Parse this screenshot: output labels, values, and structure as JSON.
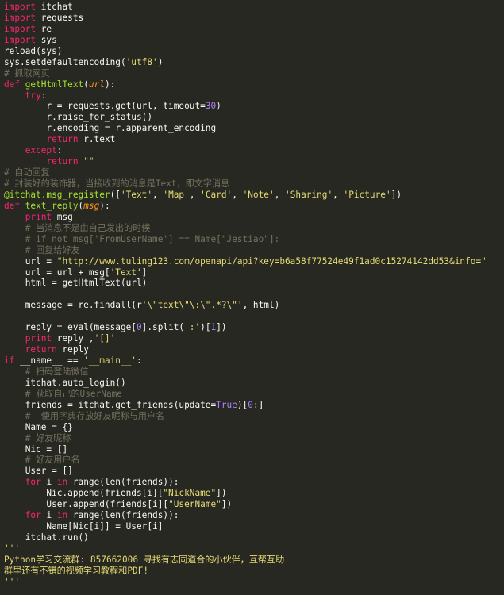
{
  "editor": {
    "theme_colors": {
      "background": "#272822",
      "keyword": "#f92672",
      "string": "#e6db74",
      "number": "#ae81ff",
      "comment": "#75715e",
      "function": "#a6e22e",
      "text": "#f8f8f2"
    },
    "lines": [
      [
        [
          "kw",
          "import"
        ],
        [
          "plain",
          " itchat"
        ]
      ],
      [
        [
          "kw",
          "import"
        ],
        [
          "plain",
          " requests"
        ]
      ],
      [
        [
          "kw",
          "import"
        ],
        [
          "plain",
          " re"
        ]
      ],
      [
        [
          "kw",
          "import"
        ],
        [
          "plain",
          " sys"
        ]
      ],
      [
        [
          "plain",
          "reload(sys)"
        ]
      ],
      [
        [
          "plain",
          "sys.setdefaultencoding("
        ],
        [
          "str",
          "'utf8'"
        ],
        [
          "plain",
          ")"
        ]
      ],
      [
        [
          "cmt",
          "# 抓取网页"
        ]
      ],
      [
        [
          "kw",
          "def"
        ],
        [
          "plain",
          " "
        ],
        [
          "fn",
          "getHtmlText"
        ],
        [
          "plain",
          "("
        ],
        [
          "param",
          "url"
        ],
        [
          "plain",
          "):"
        ]
      ],
      [
        [
          "plain",
          "    "
        ],
        [
          "kw",
          "try"
        ],
        [
          "plain",
          ":"
        ]
      ],
      [
        [
          "plain",
          "        r = requests.get(url, timeout="
        ],
        [
          "num",
          "30"
        ],
        [
          "plain",
          ")"
        ]
      ],
      [
        [
          "plain",
          "        r.raise_for_status()"
        ]
      ],
      [
        [
          "plain",
          "        r.encoding = r.apparent_encoding"
        ]
      ],
      [
        [
          "plain",
          "        "
        ],
        [
          "kw",
          "return"
        ],
        [
          "plain",
          " r.text"
        ]
      ],
      [
        [
          "plain",
          "    "
        ],
        [
          "kw",
          "except"
        ],
        [
          "plain",
          ":"
        ]
      ],
      [
        [
          "plain",
          "        "
        ],
        [
          "kw",
          "return"
        ],
        [
          "plain",
          " "
        ],
        [
          "str",
          "\"\""
        ]
      ],
      [
        [
          "cmt",
          "# 自动回复"
        ]
      ],
      [
        [
          "cmt",
          "# 封装好的装饰器，当接收到的消息是Text，即文字消息"
        ]
      ],
      [
        [
          "dec",
          "@itchat.msg_register"
        ],
        [
          "plain",
          "(["
        ],
        [
          "str",
          "'Text'"
        ],
        [
          "plain",
          ", "
        ],
        [
          "str",
          "'Map'"
        ],
        [
          "plain",
          ", "
        ],
        [
          "str",
          "'Card'"
        ],
        [
          "plain",
          ", "
        ],
        [
          "str",
          "'Note'"
        ],
        [
          "plain",
          ", "
        ],
        [
          "str",
          "'Sharing'"
        ],
        [
          "plain",
          ", "
        ],
        [
          "str",
          "'Picture'"
        ],
        [
          "plain",
          "])"
        ]
      ],
      [
        [
          "kw",
          "def"
        ],
        [
          "plain",
          " "
        ],
        [
          "fn",
          "text_reply"
        ],
        [
          "plain",
          "("
        ],
        [
          "param",
          "msg"
        ],
        [
          "plain",
          "):"
        ]
      ],
      [
        [
          "plain",
          "    "
        ],
        [
          "kw",
          "print"
        ],
        [
          "plain",
          " msg"
        ]
      ],
      [
        [
          "plain",
          "    "
        ],
        [
          "cmt",
          "# 当消息不是由自己发出的时候"
        ]
      ],
      [
        [
          "plain",
          "    "
        ],
        [
          "cmt",
          "# if not msg['FromUserName'] == Name[\"Jestiao\"]:"
        ]
      ],
      [
        [
          "plain",
          "    "
        ],
        [
          "cmt",
          "# 回复给好友"
        ]
      ],
      [
        [
          "plain",
          "    url = "
        ],
        [
          "str",
          "\"http://www.tuling123.com/openapi/api?key=b6a58f77524e49f1ad0c15274142dd53&info=\""
        ]
      ],
      [
        [
          "plain",
          "    url = url + msg["
        ],
        [
          "str",
          "'Text'"
        ],
        [
          "plain",
          "]"
        ]
      ],
      [
        [
          "plain",
          "    html = getHtmlText(url)"
        ]
      ],
      [
        [
          "plain",
          ""
        ]
      ],
      [
        [
          "plain",
          "    message = re.findall(r"
        ],
        [
          "str",
          "'\\\"text\\\"\\:\\\".*?\\\"'"
        ],
        [
          "plain",
          ", html)"
        ]
      ],
      [
        [
          "plain",
          ""
        ]
      ],
      [
        [
          "plain",
          "    reply = eval(message["
        ],
        [
          "num",
          "0"
        ],
        [
          "plain",
          "].split("
        ],
        [
          "str",
          "':'"
        ],
        [
          "plain",
          ")["
        ],
        [
          "num",
          "1"
        ],
        [
          "plain",
          "])"
        ]
      ],
      [
        [
          "plain",
          "    "
        ],
        [
          "kw",
          "print"
        ],
        [
          "plain",
          " reply ,"
        ],
        [
          "str",
          "'[]'"
        ]
      ],
      [
        [
          "plain",
          "    "
        ],
        [
          "kw",
          "return"
        ],
        [
          "plain",
          " reply"
        ]
      ],
      [
        [
          "kw",
          "if"
        ],
        [
          "plain",
          " __name__ == "
        ],
        [
          "str",
          "'__main__'"
        ],
        [
          "plain",
          ":"
        ]
      ],
      [
        [
          "plain",
          "    "
        ],
        [
          "cmt",
          "# 扫码登陆微信"
        ]
      ],
      [
        [
          "plain",
          "    itchat.auto_login()"
        ]
      ],
      [
        [
          "plain",
          "    "
        ],
        [
          "cmt",
          "# 获取自己的UserName"
        ]
      ],
      [
        [
          "plain",
          "    friends = itchat.get_friends(update="
        ],
        [
          "num",
          "True"
        ],
        [
          "plain",
          ")["
        ],
        [
          "num",
          "0"
        ],
        [
          "plain",
          ":]"
        ]
      ],
      [
        [
          "plain",
          "    "
        ],
        [
          "cmt",
          "#  使用字典存放好友昵称与用户名"
        ]
      ],
      [
        [
          "plain",
          "    Name = {}"
        ]
      ],
      [
        [
          "plain",
          "    "
        ],
        [
          "cmt",
          "# 好友昵称"
        ]
      ],
      [
        [
          "plain",
          "    Nic = []"
        ]
      ],
      [
        [
          "plain",
          "    "
        ],
        [
          "cmt",
          "# 好友用户名"
        ]
      ],
      [
        [
          "plain",
          "    User = []"
        ]
      ],
      [
        [
          "plain",
          "    "
        ],
        [
          "kw",
          "for"
        ],
        [
          "plain",
          " i "
        ],
        [
          "kw",
          "in"
        ],
        [
          "plain",
          " range(len(friends)):"
        ]
      ],
      [
        [
          "plain",
          "        Nic.append(friends[i]["
        ],
        [
          "str",
          "\"NickName\""
        ],
        [
          "plain",
          "])"
        ]
      ],
      [
        [
          "plain",
          "        User.append(friends[i]["
        ],
        [
          "str",
          "\"UserName\""
        ],
        [
          "plain",
          "])"
        ]
      ],
      [
        [
          "plain",
          "    "
        ],
        [
          "kw",
          "for"
        ],
        [
          "plain",
          " i "
        ],
        [
          "kw",
          "in"
        ],
        [
          "plain",
          " range(len(friends)):"
        ]
      ],
      [
        [
          "plain",
          "        Name[Nic[i]] = User[i]"
        ]
      ],
      [
        [
          "plain",
          "    itchat.run()"
        ]
      ],
      [
        [
          "str",
          "'''"
        ]
      ],
      [
        [
          "str",
          "Python学习交流群: 857662006 寻找有志同道合的小伙伴，互帮互助"
        ]
      ],
      [
        [
          "str",
          "群里还有不错的视频学习教程和PDF!"
        ]
      ],
      [
        [
          "str",
          "'''"
        ]
      ]
    ]
  }
}
